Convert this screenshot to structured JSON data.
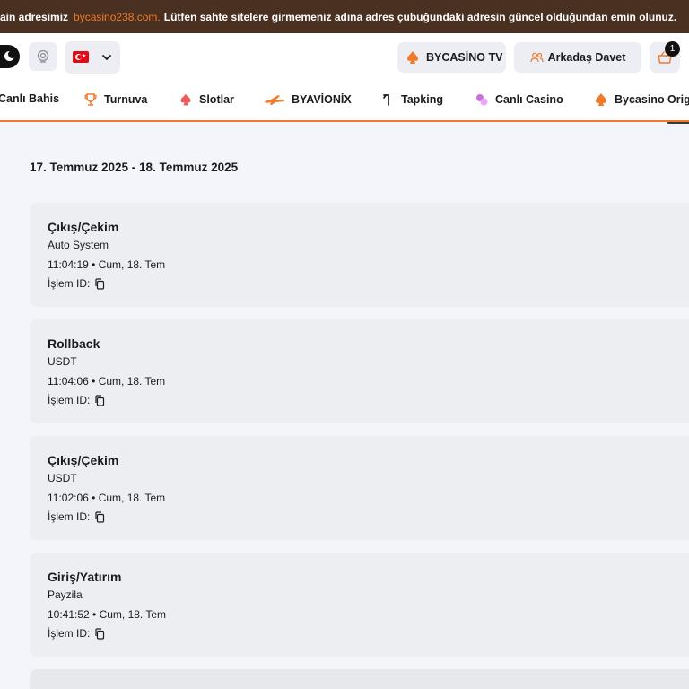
{
  "banner": {
    "prefix": "ain adresimiz",
    "domain": "bycasino238.com.",
    "message": "Lütfen sahte sitelere girmemeniz adına adres çubuğundaki adresin güncel olduğundan emin olunuz."
  },
  "header": {
    "tv_label": "BYCASİNO TV",
    "invite_label": "Arkadaş Davet",
    "cart_count": "1"
  },
  "nav": {
    "items": [
      {
        "label": "Canlı Bahis"
      },
      {
        "label": "Turnuva",
        "icon": "trophy-icon"
      },
      {
        "label": "Slotlar",
        "icon": "spade-icon"
      },
      {
        "label": "BYAVİONİX",
        "icon": "plane-icon"
      },
      {
        "label": "Tapking",
        "icon": "tap-icon"
      },
      {
        "label": "Canlı Casino",
        "icon": "chips-icon"
      },
      {
        "label": "Bycasino Origi",
        "icon": "bycasino-logo-icon"
      }
    ]
  },
  "history": {
    "date_range": "17. Temmuz 2025 - 18. Temmuz 2025",
    "id_label": "İşlem ID:",
    "transactions": [
      {
        "type": "Çıkış/Çekim",
        "method": "Auto System",
        "time": "11:04:19 • Cum, 18. Tem"
      },
      {
        "type": "Rollback",
        "method": "USDT",
        "time": "11:04:06 • Cum, 18. Tem"
      },
      {
        "type": "Çıkış/Çekim",
        "method": "USDT",
        "time": "11:02:06 • Cum, 18. Tem"
      },
      {
        "type": "Giriş/Yatırım",
        "method": "Payzila",
        "time": "10:41:52 • Cum, 18. Tem"
      }
    ]
  },
  "colors": {
    "accent": "#f07a2c",
    "banner_bg": "#4a3020",
    "card_bg": "#eceef1",
    "page_bg": "#f4f5fa"
  }
}
